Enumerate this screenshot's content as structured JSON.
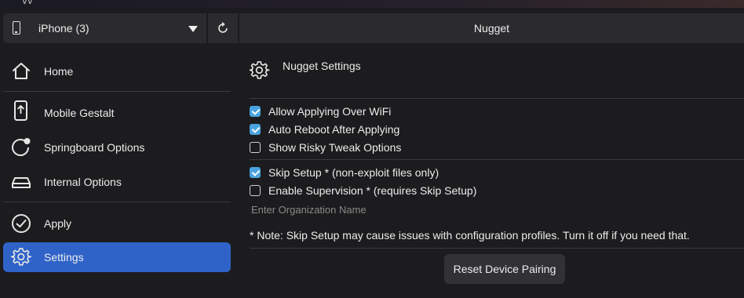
{
  "device_bar": {
    "device_name": "iPhone (3)",
    "icon": "phone-icon"
  },
  "header": {
    "title": "Nugget"
  },
  "sidebar": {
    "items": [
      {
        "label": "Home",
        "icon": "home-icon",
        "active": false
      },
      {
        "label": "Mobile Gestalt",
        "icon": "mobile-upload-icon",
        "active": false
      },
      {
        "label": "Springboard Options",
        "icon": "springboard-icon",
        "active": false
      },
      {
        "label": "Internal Options",
        "icon": "drive-icon",
        "active": false
      },
      {
        "label": "Apply",
        "icon": "checkmark-circle-icon",
        "active": false
      },
      {
        "label": "Settings",
        "icon": "gear-icon",
        "active": true
      }
    ]
  },
  "main": {
    "title": "Nugget Settings",
    "options": [
      {
        "label": "Allow Applying Over WiFi",
        "checked": true
      },
      {
        "label": "Auto Reboot After Applying",
        "checked": true
      },
      {
        "label": "Show Risky Tweak Options",
        "checked": false
      },
      {
        "label": "Skip Setup * (non-exploit files only)",
        "checked": true
      },
      {
        "label": "Enable Supervision * (requires Skip Setup)",
        "checked": false
      }
    ],
    "org_name": {
      "value": "",
      "placeholder": "Enter Organization Name"
    },
    "note": "* Note: Skip Setup may cause issues with configuration profiles. Turn it off if you need that.",
    "reset_button": "Reset Device Pairing"
  },
  "colors": {
    "accent": "#2f63c8",
    "checkbox_on": "#4aa3e0",
    "background": "#1c1c1e",
    "panel": "#2b2b2e"
  }
}
